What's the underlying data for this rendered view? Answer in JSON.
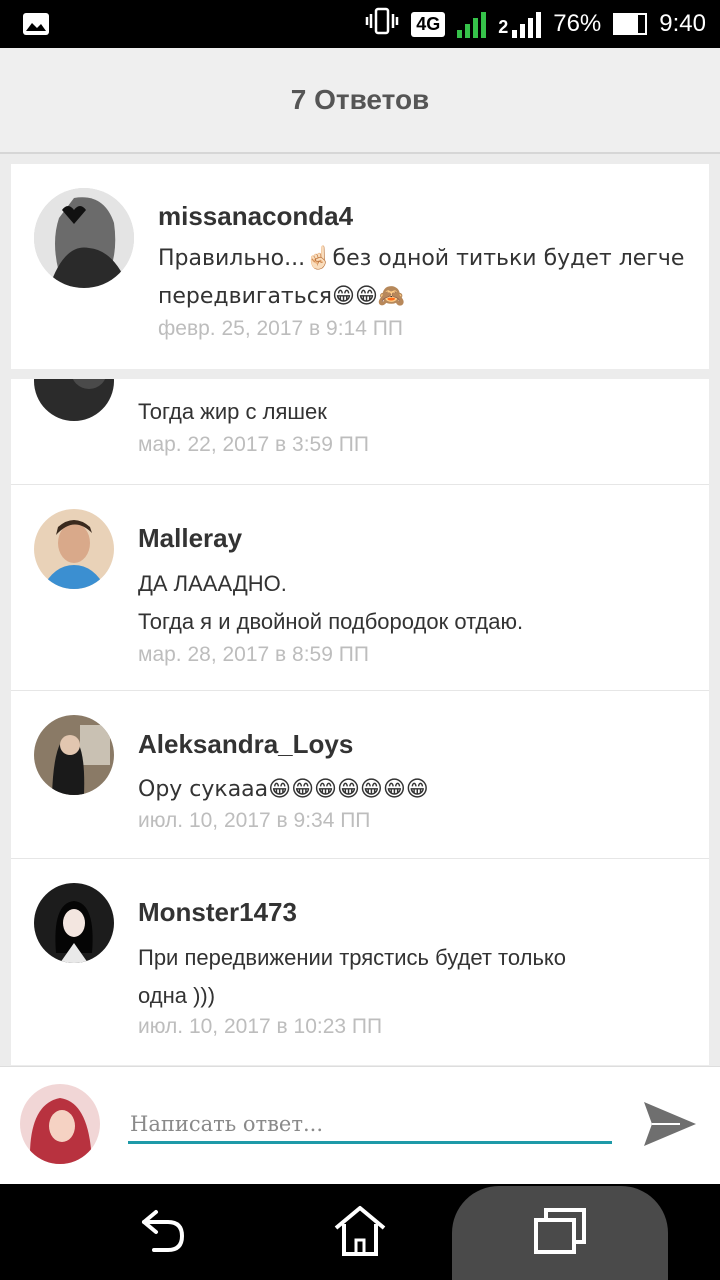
{
  "status_bar": {
    "network": "4G",
    "sim2": "2",
    "battery": "76%",
    "battery_level": 0.76,
    "time": "9:40"
  },
  "header": {
    "title": "7 Ответов"
  },
  "pinned_comment": {
    "username": "missanaconda4",
    "text_line1": "Правильно...☝🏻без одной титьки будет легче",
    "text_line2": "передвигаться😁😁🙈",
    "date": "февр. 25, 2017 в 9:14 ПП"
  },
  "replies": [
    {
      "username": "",
      "lines": [
        "Тогда жир с ляшек"
      ],
      "date": "мар. 22, 2017 в 3:59 ПП"
    },
    {
      "username": "Malleray",
      "lines": [
        "ДА ЛАААДНО.",
        "Тогда я и двойной подбородок отдаю."
      ],
      "date": "мар. 28, 2017 в 8:59 ПП"
    },
    {
      "username": "Aleksandra_Loys",
      "lines": [
        "Ору сукааа😁😁😁😁😁😁😁"
      ],
      "date": "июл. 10, 2017 в 9:34 ПП"
    },
    {
      "username": "Monster1473",
      "lines": [
        "При передвижении трястись будет только",
        "одна )))"
      ],
      "date": "июл. 10, 2017 в 10:23 ПП"
    }
  ],
  "reply_box": {
    "placeholder": "Написать ответ...",
    "value": ""
  },
  "icons": {
    "status_left": "image-icon",
    "vibrate": "vibrate-icon",
    "send": "send-icon",
    "back": "back-icon",
    "home": "home-icon",
    "recents": "recents-icon"
  },
  "colors": {
    "accent": "#1e9aa8",
    "date_gray": "#bdbdbd",
    "header_bg": "#efefef"
  }
}
